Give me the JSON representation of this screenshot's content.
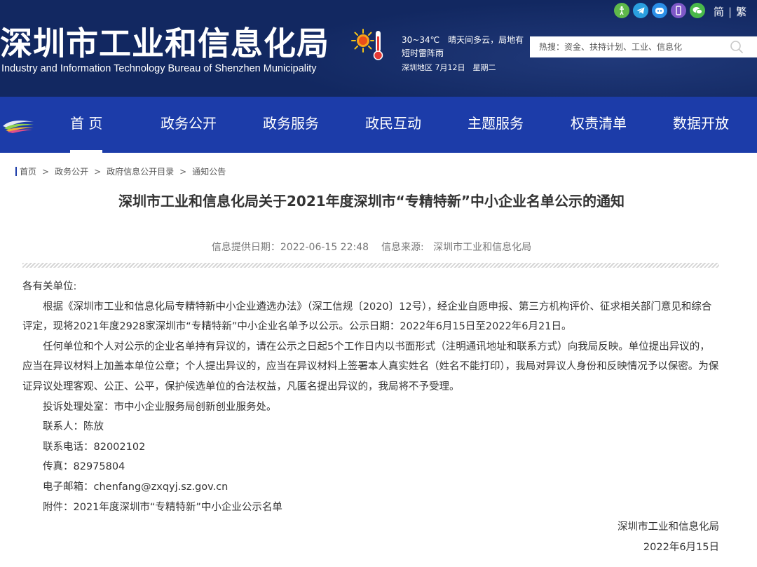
{
  "header": {
    "site_title": "深圳市工业和信息化局",
    "site_subtitle": "Industry and Information Technology Bureau of Shenzhen Municipality",
    "weather": {
      "forecast": "30~34℃　晴天间多云，局地有短时雷阵雨",
      "region_date": "深圳地区 7月12日　星期二",
      "icon": "sun-thermometer-icon"
    },
    "top_icons": [
      "accessibility-icon",
      "telegram-icon",
      "robot-chat-icon",
      "mobile-icon",
      "wechat-icon"
    ],
    "lang": {
      "simplified": "简",
      "traditional": "繁"
    },
    "search": {
      "placeholder": "热搜：资金、扶持计划、工业、信息化"
    },
    "colors": {
      "header_bg": "#122861",
      "nav_bg": "#1c3ca9"
    }
  },
  "nav": {
    "items": [
      {
        "label": "首 页",
        "active": true
      },
      {
        "label": "政务公开"
      },
      {
        "label": "政务服务"
      },
      {
        "label": "政民互动"
      },
      {
        "label": "主题服务"
      },
      {
        "label": "权责清单"
      },
      {
        "label": "数据开放"
      }
    ]
  },
  "breadcrumb": [
    "首页",
    "政务公开",
    "政府信息公开目录",
    "通知公告"
  ],
  "article": {
    "title": "深圳市工业和信息化局关于2021年度深圳市“专精特新”中小企业名单公示的通知",
    "meta": {
      "date_label": "信息提供日期：2022-06-15 22:48",
      "source_label": "信息来源:",
      "source": "深圳市工业和信息化局"
    },
    "greeting": "各有关单位:",
    "paragraphs": [
      "根据《深圳市工业和信息化局专精特新中小企业遴选办法》（深工信规〔2020〕12号），经企业自愿申报、第三方机构评价、征求相关部门意见和综合评定，现将2021年度2928家深圳市“专精特新”中小企业名单予以公示。公示日期：2022年6月15日至2022年6月21日。",
      "任何单位和个人对公示的企业名单持有异议的，请在公示之日起5个工作日内以书面形式（注明通讯地址和联系方式）向我局反映。单位提出异议的，应当在异议材料上加盖本单位公章；个人提出异议的，应当在异议材料上签署本人真实姓名（姓名不能打印），我局对异议人身份和反映情况予以保密。为保证异议处理客观、公正、公平，保护候选单位的合法权益，凡匿名提出异议的，我局将不予受理。"
    ],
    "contact": {
      "office": "投诉处理处室：市中小企业服务局创新创业服务处。",
      "person": "联系人：陈放",
      "phone": "联系电话：82002102",
      "fax": "传真：82975804",
      "email_label": "电子邮箱：",
      "email": "chenfang@zxqyj.sz.gov.cn",
      "attachment_label": "附件：",
      "attachment": "2021年度深圳市“专精特新”中小企业公示名单"
    },
    "signature": {
      "org": "深圳市工业和信息化局",
      "date": "2022年6月15日"
    }
  }
}
